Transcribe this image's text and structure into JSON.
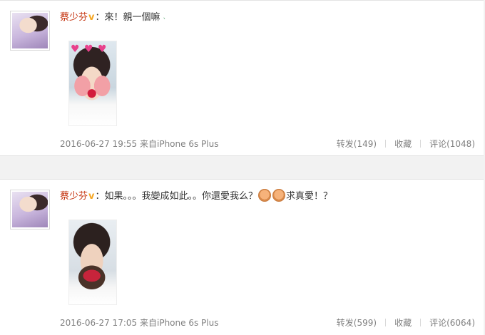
{
  "posts": [
    {
      "author": "蔡少芬",
      "verified_mark": "v",
      "colon": "：",
      "text": "來！親一個嘛",
      "photo_stickers": "♥ ♥ ♥",
      "time": "2016-06-27 19:55",
      "source": "来自iPhone 6s Plus",
      "repost": "转发(149)",
      "favorite": "收藏",
      "comment": "评论(1048)"
    },
    {
      "author": "蔡少芬",
      "verified_mark": "v",
      "colon": "：",
      "text_before": "如果。。。我變成如此。。你還愛我么？",
      "text_after": "求真愛！？",
      "time": "2016-06-27 17:05",
      "source": "来自iPhone 6s Plus",
      "repost": "转发(599)",
      "favorite": "收藏",
      "comment": "评论(6064)"
    }
  ],
  "colors": {
    "author": "#c4320e",
    "verified": "#f5a623",
    "meta": "#808080",
    "background": "#f2f2f2"
  },
  "icons": [
    "verified-v-icon",
    "emoji-icon"
  ]
}
